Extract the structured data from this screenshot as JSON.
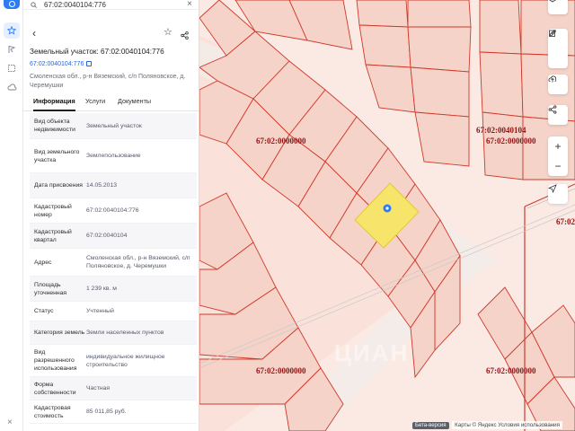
{
  "search": {
    "value": "67:02:0040104:776"
  },
  "panel": {
    "title": "Земельный участок: 67:02:0040104:776",
    "cadastral_link": "67:02:0040104:776",
    "address": "Смоленская обл., р-н Вяземский, с/п Поляновское, д. Черемушки",
    "tabs": [
      {
        "label": "Информация",
        "active": true
      },
      {
        "label": "Услуги",
        "active": false
      },
      {
        "label": "Документы",
        "active": false
      }
    ],
    "rows": [
      {
        "key": "Вид объекта недвижимости",
        "value": "Земельный участок"
      },
      {
        "key": "Вид земельного участка",
        "value": "Землепользование"
      },
      {
        "key": "Дата присвоения",
        "value": "14.05.2013"
      },
      {
        "key": "Кадастровый номер",
        "value": "67:02:0040104:776"
      },
      {
        "key": "Кадастровый квартал",
        "value": "67:02:0040104"
      },
      {
        "key": "Адрес",
        "value": "Смоленская обл., р-н Вяземский, с/п Поляновское, д. Черемушки"
      },
      {
        "key": "Площадь уточненная",
        "value": "1 239 кв. м"
      },
      {
        "key": "Статус",
        "value": "Учтенный"
      },
      {
        "key": "Категория земель",
        "value": "Земли населенных пунктов"
      },
      {
        "key": "Вид разрешенного использования",
        "value": "индивидуальное жилищное строительство"
      },
      {
        "key": "Форма собственности",
        "value": "Частная"
      },
      {
        "key": "Кадастровая стоимость",
        "value": "85 011,85 руб."
      }
    ]
  },
  "map": {
    "labels": {
      "a": "67:02:0000000",
      "b": "67:02:0040104",
      "c": "67:02:0000000",
      "d": "67:02:0000000",
      "e": "67:02:0000000",
      "f": "67:02:"
    },
    "footer": {
      "beta": "Бета-версия",
      "attribution": "Карты © Яндекс   Условия использования"
    }
  },
  "colors": {
    "accent": "#2d7cf6",
    "parcel_fill": "#f6d3c8",
    "parcel_line": "#d0392b",
    "selected_fill": "#f6e56a",
    "label": "#8a1616"
  },
  "icons": [
    "search-icon",
    "close-icon",
    "back-icon",
    "star-icon",
    "share-icon",
    "layers-icon",
    "pencil-icon",
    "edit-icon",
    "upload-icon",
    "route-icon",
    "zoom-in-icon",
    "zoom-out-icon",
    "locate-icon",
    "pin-icon"
  ]
}
